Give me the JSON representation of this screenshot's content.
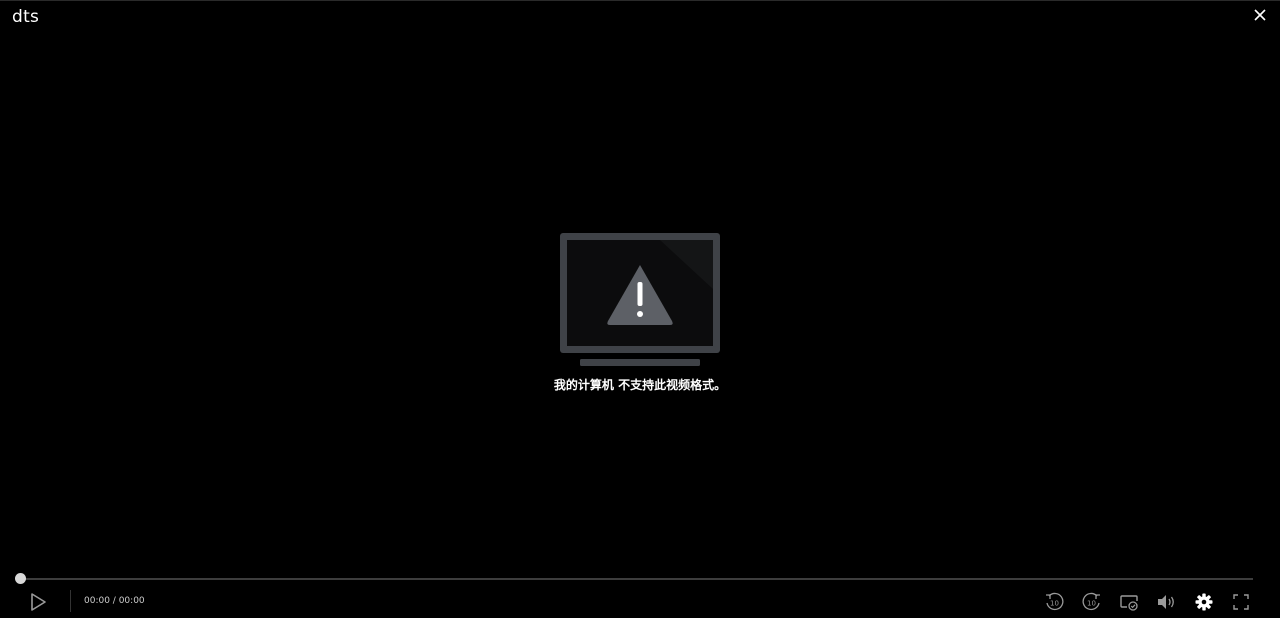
{
  "window": {
    "title": "dts"
  },
  "error": {
    "message": "我的计算机 不支持此视频格式。"
  },
  "playback": {
    "current_time": "00:00",
    "separator": " / ",
    "duration": "00:00",
    "progress": 0
  },
  "controls": {
    "icons": [
      "play-icon",
      "skip-back-10-icon",
      "skip-forward-10-icon",
      "cast-icon",
      "volume-icon",
      "settings-icon",
      "fullscreen-icon"
    ],
    "skip_back_seconds": "10",
    "skip_forward_seconds": "10"
  },
  "colors": {
    "background": "#000000",
    "icon": "#9a9a9a",
    "icon_active": "#ffffff",
    "monitor": "#3f4247",
    "progress_track": "#3d3d3d"
  }
}
